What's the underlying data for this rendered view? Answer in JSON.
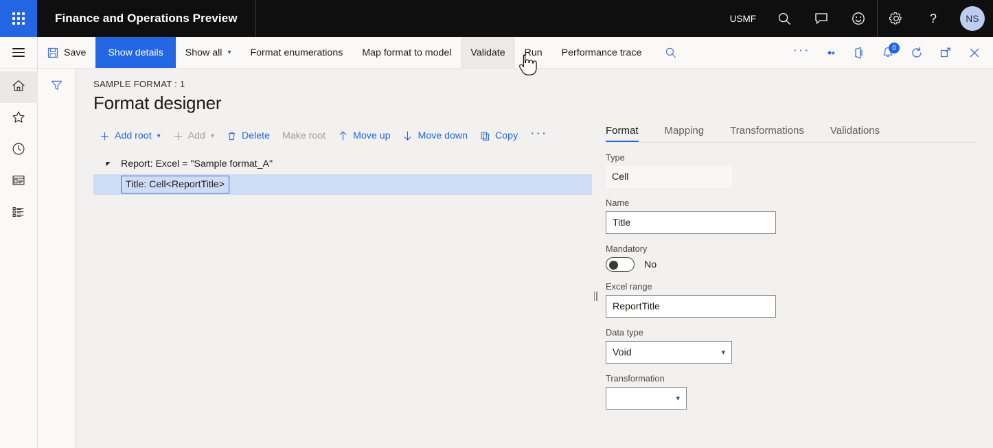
{
  "appbar": {
    "title": "Finance and Operations Preview",
    "company": "USMF",
    "waffle_icon": "waffle-grid-icon",
    "search_icon": "search-icon",
    "feedback_icon": "chat-icon",
    "smiley_icon": "smiley-icon",
    "settings_icon": "gear-icon",
    "help_icon": "help-question-icon",
    "avatar_initials": "NS"
  },
  "commandbar": {
    "menu_icon": "hamburger-menu-icon",
    "save_label": "Save",
    "save_icon": "save-disk-icon",
    "show_details_label": "Show details",
    "show_all_label": "Show all",
    "format_enumerations_label": "Format enumerations",
    "map_format_to_model_label": "Map format to model",
    "validate_label": "Validate",
    "run_label": "Run",
    "performance_trace_label": "Performance trace",
    "search_icon": "search-icon",
    "overflow_label": "···",
    "attachments_icon": "attachments-icon",
    "office_icon": "office-export-icon",
    "notifications_icon": "notification-bell-icon",
    "notifications_count": "0",
    "refresh_icon": "refresh-icon",
    "popout_icon": "open-in-new-window-icon",
    "close_icon": "close-icon"
  },
  "rail": {
    "items": [
      {
        "icon": "home-icon",
        "name": "home"
      },
      {
        "icon": "star-favorites-icon",
        "name": "favorites"
      },
      {
        "icon": "clock-recent-icon",
        "name": "recent"
      },
      {
        "icon": "workspaces-icon",
        "name": "workspaces"
      },
      {
        "icon": "modules-list-icon",
        "name": "modules"
      }
    ]
  },
  "filter": {
    "icon": "filter-funnel-icon"
  },
  "page": {
    "breadcrumb": "SAMPLE FORMAT : 1",
    "title": "Format designer"
  },
  "actions": [
    {
      "label": "Add root",
      "icon": "plus-icon",
      "has_chevron": true,
      "disabled": false
    },
    {
      "label": "Add",
      "icon": "plus-icon",
      "has_chevron": true,
      "disabled": true
    },
    {
      "label": "Delete",
      "icon": "trash-icon",
      "has_chevron": false,
      "disabled": false
    },
    {
      "label": "Make root",
      "icon": "",
      "has_chevron": false,
      "disabled": true
    },
    {
      "label": "Move up",
      "icon": "arrow-up-icon",
      "has_chevron": false,
      "disabled": false
    },
    {
      "label": "Move down",
      "icon": "arrow-down-icon",
      "has_chevron": false,
      "disabled": false
    },
    {
      "label": "Copy",
      "icon": "copy-icon",
      "has_chevron": false,
      "disabled": false
    }
  ],
  "actions_more_label": "···",
  "tree": {
    "root": {
      "label": "Report: Excel = \"Sample format_A\"",
      "expander_icon": "expanded-triangle-icon"
    },
    "child": {
      "label": "Title: Cell<ReportTitle>",
      "selected": true
    }
  },
  "detail": {
    "tabs": [
      {
        "label": "Format",
        "active": true
      },
      {
        "label": "Mapping",
        "active": false
      },
      {
        "label": "Transformations",
        "active": false
      },
      {
        "label": "Validations",
        "active": false
      }
    ],
    "fields": {
      "type_label": "Type",
      "type_value": "Cell",
      "name_label": "Name",
      "name_value": "Title",
      "mandatory_label": "Mandatory",
      "mandatory_value": "No",
      "excel_range_label": "Excel range",
      "excel_range_value": "ReportTitle",
      "data_type_label": "Data type",
      "data_type_value": "Void",
      "transformation_label": "Transformation",
      "transformation_value": ""
    }
  },
  "colors": {
    "brand_blue": "#2266e3",
    "appbar_black": "#0f0f0f",
    "page_bg": "#f2f1f0",
    "selection_blue": "#cfdcf5",
    "avatar_bg": "#bdcdf0"
  }
}
